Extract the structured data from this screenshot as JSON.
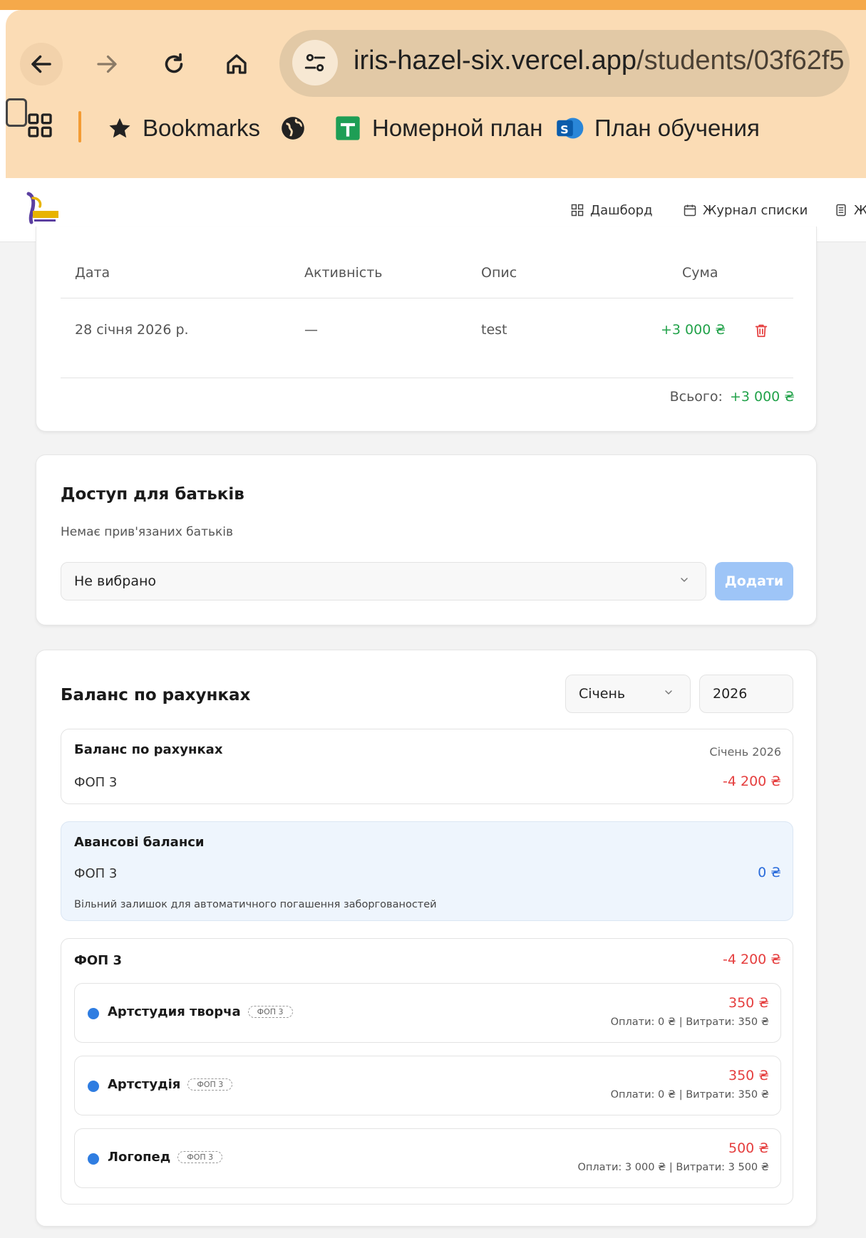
{
  "browser": {
    "url_host": "iris-hazel-six.vercel.app",
    "url_path": "/students/03f62f5",
    "bookmarks": [
      {
        "label": "Bookmarks",
        "icon": "star-icon"
      },
      {
        "label": "",
        "icon": "globe-icon"
      },
      {
        "label": "Номерной план",
        "icon": "sheets-icon"
      },
      {
        "label": "План обучения",
        "icon": "sharepoint-icon"
      }
    ]
  },
  "header": {
    "nav": [
      {
        "label": "Дашборд",
        "icon": "dashboard-icon"
      },
      {
        "label": "Журнал списки",
        "icon": "calendar-icon"
      },
      {
        "label": "Ж",
        "icon": "journal-icon"
      }
    ]
  },
  "transactions": {
    "columns": [
      "Дата",
      "Активність",
      "Опис",
      "Сума"
    ],
    "rows": [
      {
        "date": "28 січня 2026 р.",
        "activity": "—",
        "description": "test",
        "amount": "+3 000 ₴"
      }
    ],
    "total_label": "Всього:",
    "total_value": "+3 000 ₴"
  },
  "parents": {
    "title": "Доступ для батьків",
    "subtitle": "Немає прив'язаних батьків",
    "select_value": "Не вибрано",
    "add_label": "Додати"
  },
  "balance": {
    "title": "Баланс по рахунках",
    "month": "Січень",
    "year": "2026",
    "summary": {
      "title": "Баланс по рахунках",
      "period": "Січень 2026",
      "account": "ФОП 3",
      "value": "-4 200 ₴"
    },
    "advance": {
      "title": "Авансові баланси",
      "account": "ФОП 3",
      "value": "0 ₴",
      "note": "Вільний залишок для автоматичного погашення заборгованостей"
    },
    "fop": {
      "title": "ФОП 3",
      "value": "-4 200 ₴",
      "items": [
        {
          "name": "Артстудия творча",
          "tag": "ФОП 3",
          "amount": "350 ₴",
          "details": "Оплати: 0 ₴ | Витрати: 350 ₴"
        },
        {
          "name": "Артстудія",
          "tag": "ФОП 3",
          "amount": "350 ₴",
          "details": "Оплати: 0 ₴ | Витрати: 350 ₴"
        },
        {
          "name": "Логопед",
          "tag": "ФОП 3",
          "amount": "500 ₴",
          "details": "Оплати: 3 000 ₴ | Витрати: 3 500 ₴"
        }
      ]
    }
  },
  "colors": {
    "positive": "#22a24a",
    "negative": "#e53e3e",
    "accent_blue": "#2f7de1",
    "browser_frame": "#fbdcb5"
  }
}
